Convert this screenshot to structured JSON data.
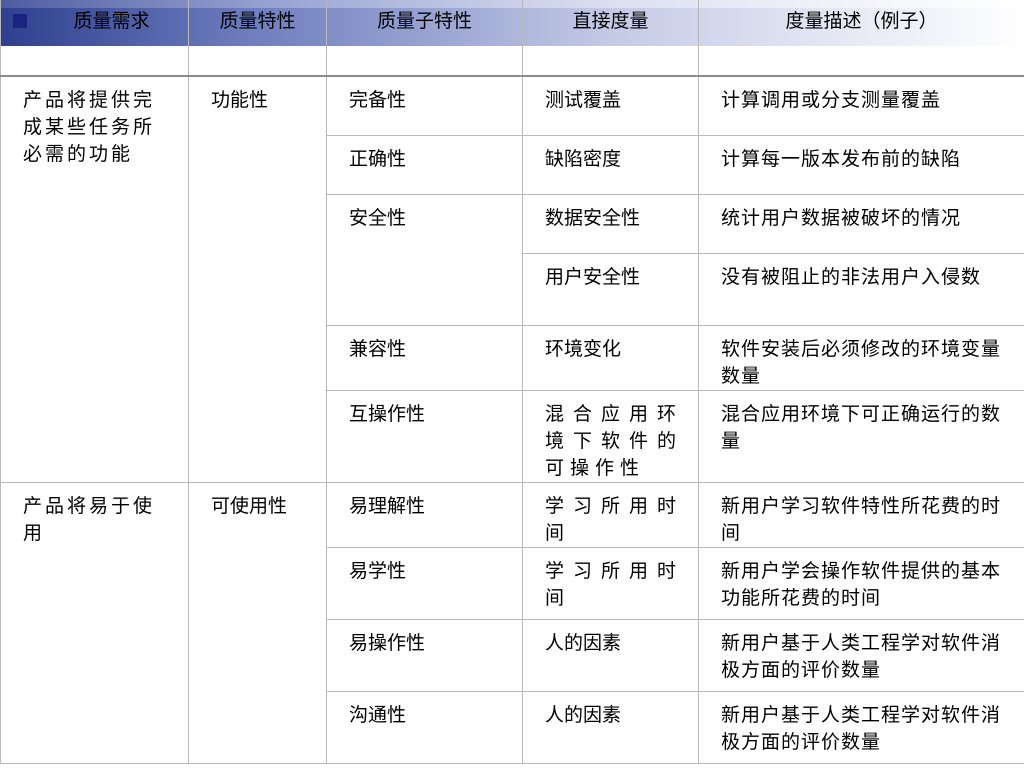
{
  "headers": [
    "质量需求",
    "质量特性",
    "质量子特性",
    "直接度量",
    "度量描述（例子）"
  ],
  "groups": [
    {
      "requirement": "产品将提供完成某些任务所必需的功能",
      "characteristic": "功能性"
    },
    {
      "requirement": "产品将易于使用",
      "characteristic": "可使用性"
    }
  ],
  "rows": [
    {
      "sub": "完备性",
      "measure": "测试覆盖",
      "desc": "计算调用或分支测量覆盖"
    },
    {
      "sub": "正确性",
      "measure": "缺陷密度",
      "desc": "计算每一版本发布前的缺陷"
    },
    {
      "sub": "安全性",
      "measure": "数据安全性",
      "desc": "统计用户数据被破坏的情况"
    },
    {
      "sub": "",
      "measure": "用户安全性",
      "desc": "没有被阻止的非法用户入侵数"
    },
    {
      "sub": "兼容性",
      "measure": "环境变化",
      "desc": "软件安装后必须修改的环境变量数量"
    },
    {
      "sub": "互操作性",
      "measure": "混合应用环境下软件的可操作性",
      "desc": "混合应用环境下可正确运行的数量"
    },
    {
      "sub": "易理解性",
      "measure": "学习所用时间",
      "desc": "新用户学习软件特性所花费的时间"
    },
    {
      "sub": "易学性",
      "measure": "学习所用时间",
      "desc": "新用户学会操作软件提供的基本功能所花费的时间"
    },
    {
      "sub": "易操作性",
      "measure": "人的因素",
      "desc": "新用户基于人类工程学对软件消极方面的评价数量"
    },
    {
      "sub": "沟通性",
      "measure": "人的因素",
      "desc": "新用户基于人类工程学对软件消极方面的评价数量"
    }
  ],
  "colors": {
    "header_dark": "#2e3f8f",
    "bullet": "#1a237e",
    "grid": "#b9b9b9"
  },
  "icons": [
    "square-bullet-icon"
  ]
}
